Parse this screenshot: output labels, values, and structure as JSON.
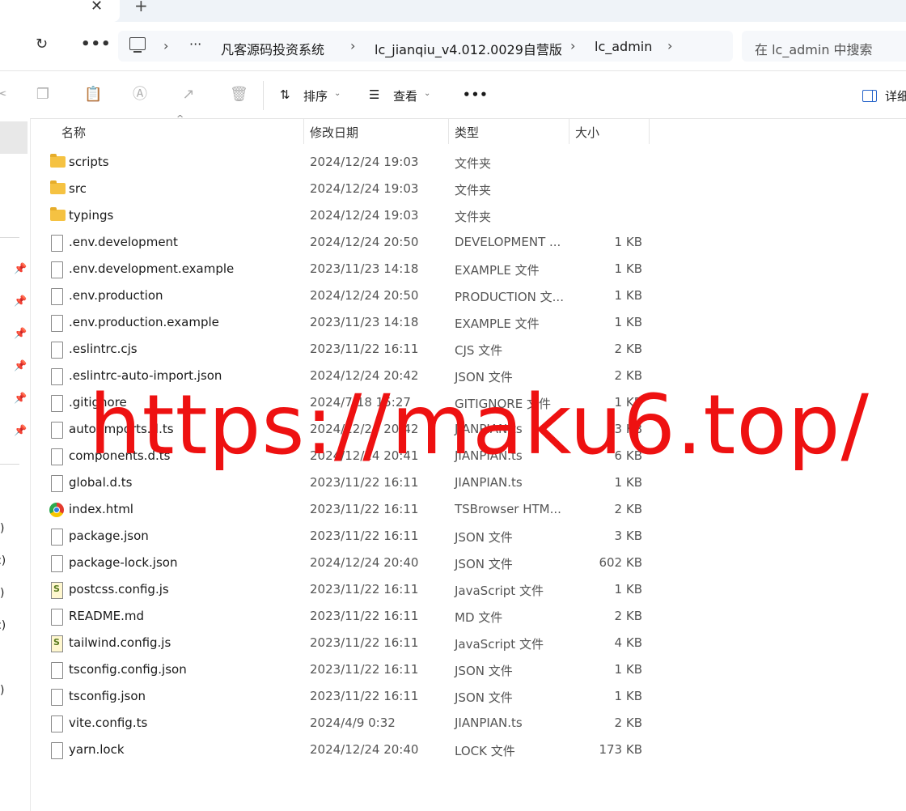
{
  "tabbar": {
    "close_glyph": "✕",
    "new_tab_glyph": "+"
  },
  "nav": {
    "refresh_glyph": "↻",
    "more_glyph": "•••",
    "breadcrumb_more": "···",
    "breadcrumbs": [
      "凡客源码投资系统",
      "lc_jianqiu_v4.012.0029自营版",
      "lc_admin"
    ],
    "search_placeholder": "在 lc_admin 中搜索"
  },
  "toolbar": {
    "sort_label": "排序",
    "view_label": "查看",
    "more_glyph": "•••",
    "details_label": "详细"
  },
  "columns": {
    "name": "名称",
    "modified": "修改日期",
    "type": "类型",
    "size": "大小"
  },
  "files": [
    {
      "icon": "folder",
      "name": "scripts",
      "date": "2024/12/24 19:03",
      "type": "文件夹",
      "size": ""
    },
    {
      "icon": "folder",
      "name": "src",
      "date": "2024/12/24 19:03",
      "type": "文件夹",
      "size": ""
    },
    {
      "icon": "folder",
      "name": "typings",
      "date": "2024/12/24 19:03",
      "type": "文件夹",
      "size": ""
    },
    {
      "icon": "file",
      "name": ".env.development",
      "date": "2024/12/24 20:50",
      "type": "DEVELOPMENT ...",
      "size": "1 KB"
    },
    {
      "icon": "file",
      "name": ".env.development.example",
      "date": "2023/11/23 14:18",
      "type": "EXAMPLE 文件",
      "size": "1 KB"
    },
    {
      "icon": "file",
      "name": ".env.production",
      "date": "2024/12/24 20:50",
      "type": "PRODUCTION 文...",
      "size": "1 KB"
    },
    {
      "icon": "file",
      "name": ".env.production.example",
      "date": "2023/11/23 14:18",
      "type": "EXAMPLE 文件",
      "size": "1 KB"
    },
    {
      "icon": "file",
      "name": ".eslintrc.cjs",
      "date": "2023/11/22 16:11",
      "type": "CJS 文件",
      "size": "2 KB"
    },
    {
      "icon": "file",
      "name": ".eslintrc-auto-import.json",
      "date": "2024/12/24 20:42",
      "type": "JSON 文件",
      "size": "2 KB"
    },
    {
      "icon": "file",
      "name": ".gitignore",
      "date": "2024/7/18 15:27",
      "type": "GITIGNORE 文件",
      "size": "1 KB"
    },
    {
      "icon": "file",
      "name": "auto-imports.d.ts",
      "date": "2024/12/24 20:42",
      "type": "JIANPIAN.ts",
      "size": "3 KB"
    },
    {
      "icon": "file",
      "name": "components.d.ts",
      "date": "2024/12/24 20:41",
      "type": "JIANPIAN.ts",
      "size": "6 KB"
    },
    {
      "icon": "file",
      "name": "global.d.ts",
      "date": "2023/11/22 16:11",
      "type": "JIANPIAN.ts",
      "size": "1 KB"
    },
    {
      "icon": "browser",
      "name": "index.html",
      "date": "2023/11/22 16:11",
      "type": "TSBrowser HTM...",
      "size": "2 KB"
    },
    {
      "icon": "file",
      "name": "package.json",
      "date": "2023/11/22 16:11",
      "type": "JSON 文件",
      "size": "3 KB"
    },
    {
      "icon": "file",
      "name": "package-lock.json",
      "date": "2024/12/24 20:40",
      "type": "JSON 文件",
      "size": "602 KB"
    },
    {
      "icon": "js",
      "name": "postcss.config.js",
      "date": "2023/11/22 16:11",
      "type": "JavaScript 文件",
      "size": "1 KB"
    },
    {
      "icon": "file",
      "name": "README.md",
      "date": "2023/11/22 16:11",
      "type": "MD 文件",
      "size": "2 KB"
    },
    {
      "icon": "js",
      "name": "tailwind.config.js",
      "date": "2023/11/22 16:11",
      "type": "JavaScript 文件",
      "size": "4 KB"
    },
    {
      "icon": "file",
      "name": "tsconfig.config.json",
      "date": "2023/11/22 16:11",
      "type": "JSON 文件",
      "size": "1 KB"
    },
    {
      "icon": "file",
      "name": "tsconfig.json",
      "date": "2023/11/22 16:11",
      "type": "JSON 文件",
      "size": "1 KB"
    },
    {
      "icon": "file",
      "name": "vite.config.ts",
      "date": "2024/4/9 0:32",
      "type": "JIANPIAN.ts",
      "size": "2 KB"
    },
    {
      "icon": "file",
      "name": "yarn.lock",
      "date": "2024/12/24 20:40",
      "type": "LOCK 文件",
      "size": "173 KB"
    }
  ],
  "leftpane": {
    "pin_glyph": "📌",
    "paren_items": [
      ")",
      "c)",
      ")",
      "c)",
      ")"
    ]
  },
  "watermark": "https://maku6.top/"
}
